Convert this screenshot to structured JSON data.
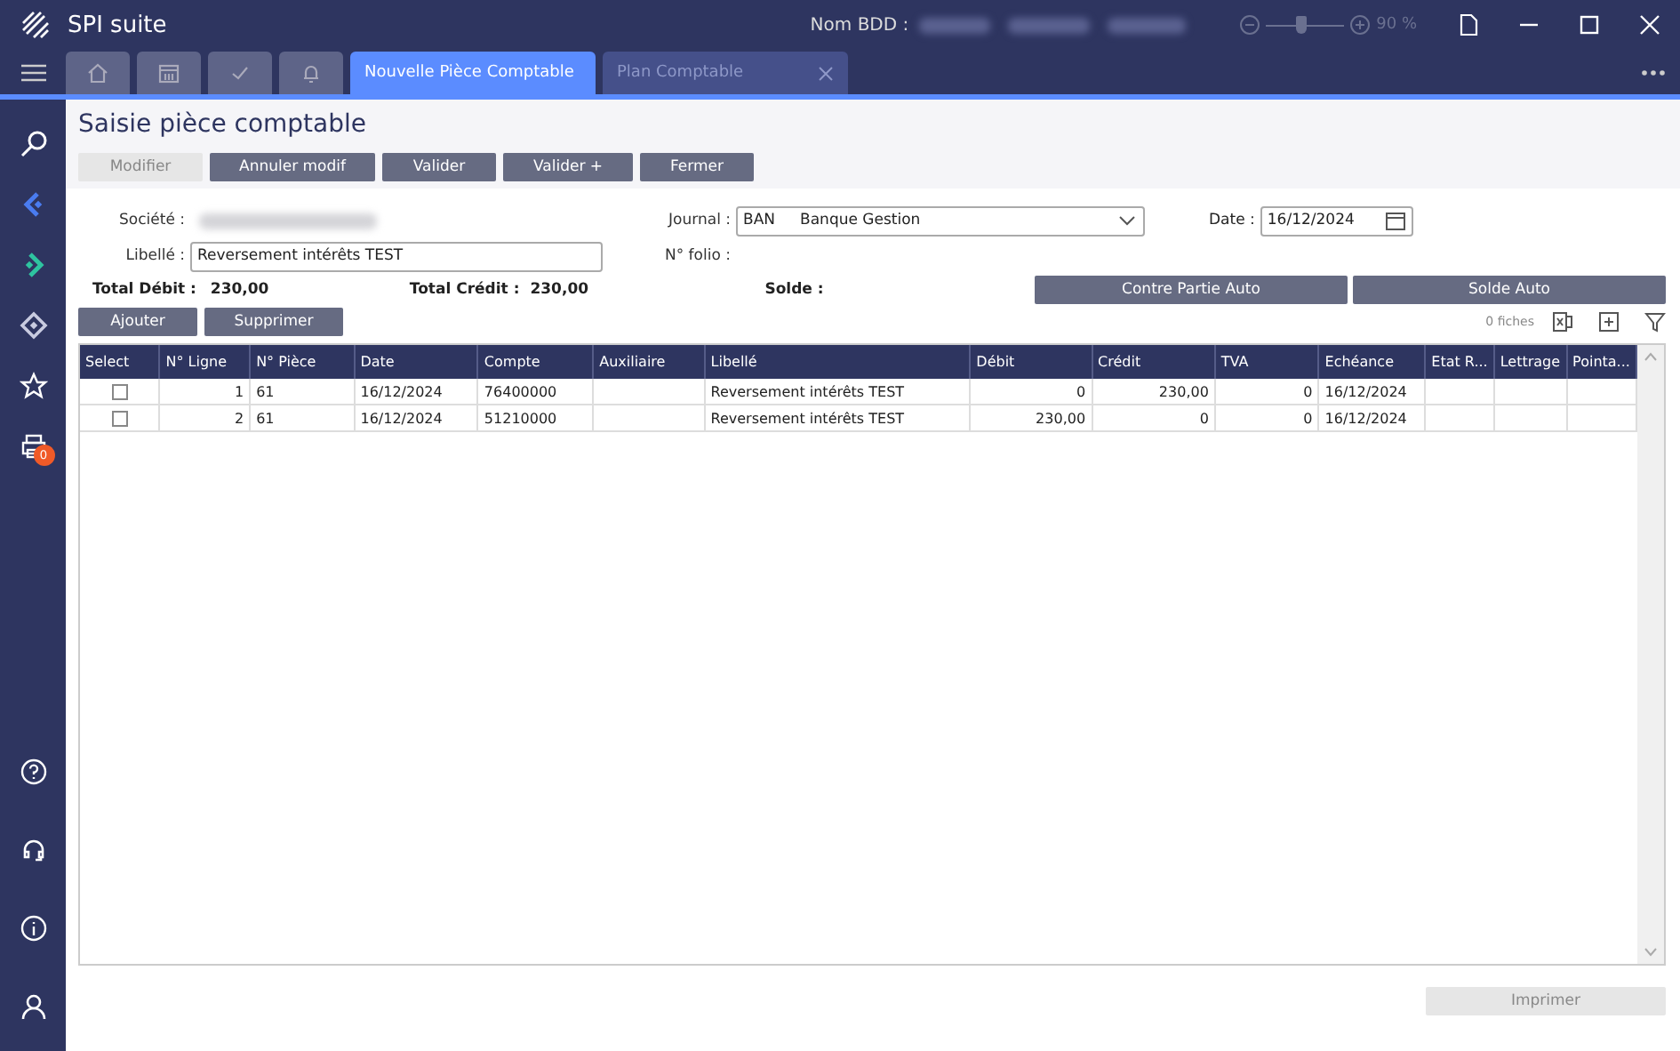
{
  "window": {
    "title": "SPI suite",
    "db_label": "Nom BDD :",
    "zoom": {
      "level": 0.45,
      "reading": "90 %"
    }
  },
  "tabs": [
    {
      "kind": "home",
      "selected": false
    },
    {
      "kind": "calendar",
      "selected": false
    },
    {
      "kind": "check",
      "selected": false
    },
    {
      "kind": "bell",
      "selected": false
    },
    {
      "kind": "text",
      "label": "Nouvelle Pièce Comptable",
      "selected": true
    },
    {
      "kind": "text",
      "label": "Plan Comptable",
      "selected": false,
      "closable": true
    }
  ],
  "sidebar": {
    "badge": "0"
  },
  "page": {
    "title": "Saisie pièce comptable",
    "toolbar": [
      {
        "label": "Modifier",
        "disabled": true
      },
      {
        "label": "Annuler modif",
        "disabled": false
      },
      {
        "label": "Valider",
        "disabled": false
      },
      {
        "label": "Valider +",
        "disabled": false
      },
      {
        "label": "Fermer",
        "disabled": false
      }
    ],
    "societe_label": "Société :",
    "journal_label": "Journal :",
    "journal_code": "BAN",
    "journal_name": "Banque Gestion",
    "date_label": "Date :",
    "date_value": "16/12/2024",
    "libelle_label": "Libellé :",
    "libelle_value": "Reversement intérêts TEST",
    "folio_label": "N° folio :",
    "total_debit_label": "Total Débit :",
    "total_debit": "230,00",
    "total_credit_label": "Total Crédit :",
    "total_credit": "230,00",
    "solde_label": "Solde :",
    "auto_buttons": [
      "Contre Partie Auto",
      "Solde Auto"
    ],
    "row_buttons": [
      "Ajouter",
      "Supprimer"
    ],
    "count": "0 fiches",
    "print_button": {
      "label": "Imprimer",
      "disabled": true
    }
  },
  "table": {
    "columns": [
      "Select",
      "N° Ligne",
      "N° Pièce",
      "Date",
      "Compte",
      "Auxiliaire",
      "Libellé",
      "Débit",
      "Crédit",
      "TVA",
      "Echéance",
      "Etat R...",
      "Lettrage",
      "Pointa..."
    ],
    "rows": [
      {
        "checked": false,
        "cells": [
          "",
          "1",
          "61",
          "16/12/2024",
          "76400000",
          "",
          "Reversement intérêts TEST",
          "0",
          "230,00",
          "0",
          "16/12/2024",
          "",
          "",
          ""
        ]
      },
      {
        "checked": false,
        "cells": [
          "",
          "2",
          "61",
          "16/12/2024",
          "51210000",
          "",
          "Reversement intérêts TEST",
          "230,00",
          "0",
          "0",
          "16/12/2024",
          "",
          "",
          ""
        ]
      }
    ]
  }
}
